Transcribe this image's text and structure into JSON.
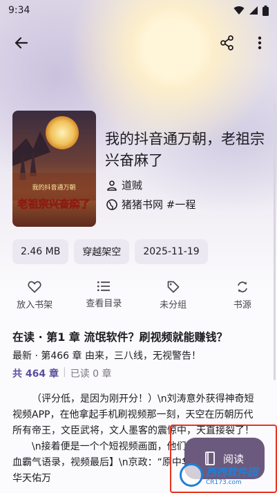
{
  "status_bar": {
    "time": "9:34"
  },
  "book": {
    "title": "我的抖音通万朝，老祖宗兴奋麻了",
    "author": "道贼",
    "source": "猪猪书网 #一程",
    "cover_title": "老祖宗兴奋麻了",
    "cover_subtitle": "我的抖音通万朝"
  },
  "chips": [
    "2.46 MB",
    "穿越架空",
    "2025-11-19"
  ],
  "actions": [
    {
      "label": "放入书架",
      "icon": "heart-outline-icon"
    },
    {
      "label": "查看目录",
      "icon": "list-icon"
    },
    {
      "label": "未分组",
      "icon": "tag-icon"
    },
    {
      "label": "书源",
      "icon": "swap-icon"
    }
  ],
  "reading": {
    "current_chapter": "在读 · 第1 章 流氓软件？刷视频就能赚钱？",
    "latest_chapter": "最新 · 第466 章 由来，三八线，无视警告！",
    "total_chapters": "共 464 章",
    "separator": "|",
    "read_count": "已读 0 章"
  },
  "intro": {
    "p1": "（评分低，是因为刚开分！）\\n刘涛意外获得神奇短视频APP，在他拿起手机刷视频那一刻，天空在历朝历代所有帝王，文臣武将，文人墨客的震惊中，天直接裂了！",
    "p2": "\\n接着便是一个个短视频画面，他们还看到了【刷热血霸气语录，视频最后】\\n京政：“原中华人人如龙，原中华天佑万"
  },
  "fab": {
    "label": "阅读"
  },
  "watermark": {
    "main": "西西软件园",
    "sub": "CR173.com"
  },
  "colors": {
    "accent": "#6b5a7e",
    "highlight_box": "#e8321e",
    "link": "#5a4fa0"
  }
}
